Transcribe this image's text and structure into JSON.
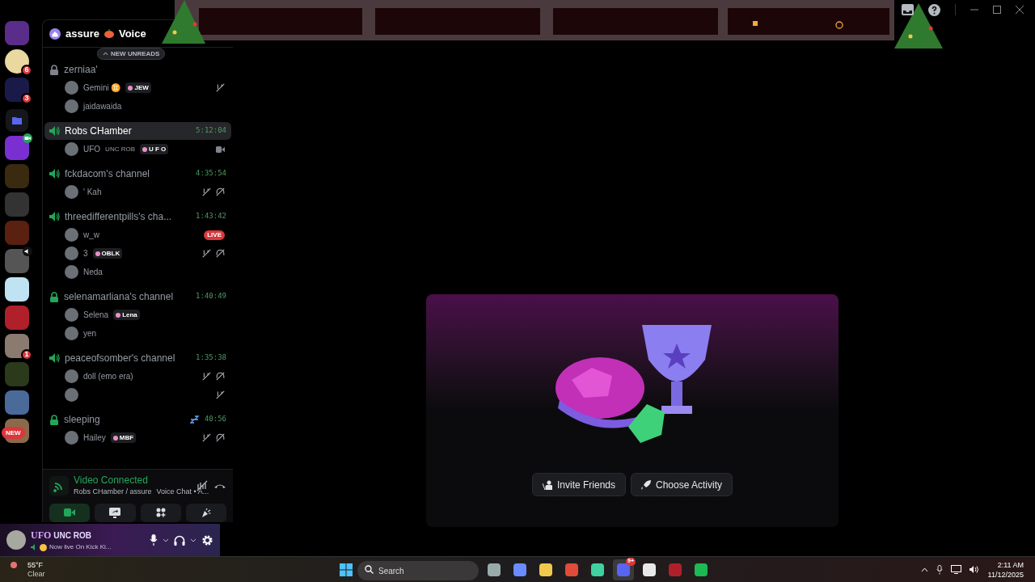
{
  "servers": [
    {
      "kind": "server"
    },
    {
      "kind": "server",
      "badge": "6"
    },
    {
      "kind": "server",
      "badge": "3"
    },
    {
      "kind": "folder"
    },
    {
      "kind": "server",
      "in_video": true
    },
    {
      "kind": "server"
    },
    {
      "kind": "server"
    },
    {
      "kind": "server"
    },
    {
      "kind": "server",
      "in_voice": true
    },
    {
      "kind": "server"
    },
    {
      "kind": "server"
    },
    {
      "kind": "server",
      "badge": "1"
    },
    {
      "kind": "server"
    },
    {
      "kind": "server"
    },
    {
      "kind": "server"
    }
  ],
  "new_pill": "NEW",
  "header": {
    "server": "assure",
    "title": "Voice"
  },
  "new_unreads": "NEW UNREADS",
  "channels": [
    {
      "kind": "locked",
      "active": false,
      "name": "zerniaa'",
      "selected": false,
      "members": [
        {
          "name": "Gemini ♊",
          "badge": "JEW",
          "muted": true,
          "deafened": false,
          "video": false,
          "live": false
        },
        {
          "name": "jaidawaida",
          "muted": false,
          "deafened": false,
          "video": false,
          "live": false
        }
      ]
    },
    {
      "kind": "voice",
      "active": true,
      "name": "Robs CHamber",
      "time": "5:12:04",
      "selected": true,
      "members": [
        {
          "name": "UFO",
          "tag": "UNC ROB",
          "badge": "U F O",
          "muted": false,
          "deafened": false,
          "video": true,
          "live": false
        }
      ]
    },
    {
      "kind": "voice",
      "active": true,
      "name": "fckdacom's channel",
      "time": "4:35:54",
      "selected": false,
      "members": [
        {
          "name": "' Kah",
          "muted": true,
          "deafened": true,
          "video": false,
          "live": false
        }
      ]
    },
    {
      "kind": "voice",
      "active": true,
      "name": "threedifferentpills's cha...",
      "time": "1:43:42",
      "selected": false,
      "members": [
        {
          "name": "w_w",
          "muted": false,
          "deafened": false,
          "video": false,
          "live": true,
          "live_label": "LIVE"
        },
        {
          "name": "3",
          "badge": "OBLK",
          "muted": true,
          "deafened": true,
          "video": false,
          "live": false
        },
        {
          "name": "Neda",
          "muted": false,
          "deafened": false,
          "video": false,
          "live": false
        }
      ]
    },
    {
      "kind": "locked",
      "active": true,
      "name": "selenamarliana's channel",
      "time": "1:40:49",
      "selected": false,
      "members": [
        {
          "name": "Selena",
          "badge": "Lena",
          "muted": false,
          "deafened": false,
          "video": false,
          "live": false
        },
        {
          "name": "yen",
          "muted": false,
          "deafened": false,
          "video": false,
          "live": false
        }
      ]
    },
    {
      "kind": "voice",
      "active": true,
      "name": "peaceofsomber's channel",
      "time": "1:35:38",
      "selected": false,
      "members": [
        {
          "name": "doll (emo era)",
          "muted": true,
          "deafened": true,
          "video": false,
          "live": false
        },
        {
          "muted": true,
          "deafened": false,
          "video": false,
          "live": false
        }
      ]
    },
    {
      "kind": "locked",
      "active": true,
      "name": "sleeping",
      "time": "40:56",
      "selected": false,
      "members": [
        {
          "name": "Hailey",
          "badge": "MBF",
          "muted": true,
          "deafened": true,
          "video": false,
          "live": false
        }
      ]
    }
  ],
  "voice_panel": {
    "status": "Video Connected",
    "detail": "Robs CHamber / assure",
    "detail_tail": "Voice Chat • A...",
    "camera_on": true
  },
  "user_panel": {
    "name": "UFO",
    "tag": "UNC ROB",
    "status": "Now live On Kick Ki..."
  },
  "weather": {
    "temperature": "55°F",
    "condition": "Clear"
  },
  "activity_card": {
    "buttons": [
      {
        "kind": "invite",
        "label": "Invite Friends"
      },
      {
        "kind": "activity",
        "label": "Choose Activity"
      }
    ]
  },
  "taskbar": {
    "search_placeholder": "Search",
    "apps": [
      {
        "kind": "taskview",
        "selected": false
      },
      {
        "kind": "copilot",
        "selected": false
      },
      {
        "kind": "files",
        "selected": false
      },
      {
        "kind": "chrome",
        "selected": false
      },
      {
        "kind": "app",
        "selected": false
      },
      {
        "kind": "discord",
        "selected": true,
        "badge": "9+"
      },
      {
        "kind": "audio",
        "selected": false
      },
      {
        "kind": "voicemeeter",
        "selected": false
      },
      {
        "kind": "spotify",
        "selected": false
      }
    ],
    "time": "2:11 AM",
    "date": "11/12/2025"
  }
}
